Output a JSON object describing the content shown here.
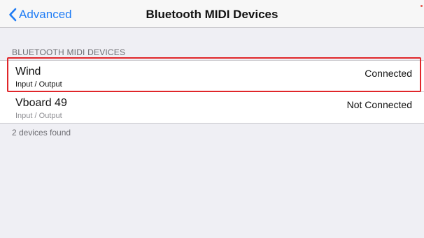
{
  "nav": {
    "back_label": "Advanced",
    "title": "Bluetooth MIDI Devices"
  },
  "section": {
    "header": "BLUETOOTH MIDI DEVICES"
  },
  "devices": [
    {
      "name": "Wind",
      "type": "Input / Output",
      "status": "Connected"
    },
    {
      "name": "Vboard 49",
      "type": "Input / Output",
      "status": "Not Connected"
    }
  ],
  "footer": "2 devices found",
  "colors": {
    "accent": "#1f7cf5",
    "highlight": "#e0262a",
    "background": "#efeff4"
  }
}
